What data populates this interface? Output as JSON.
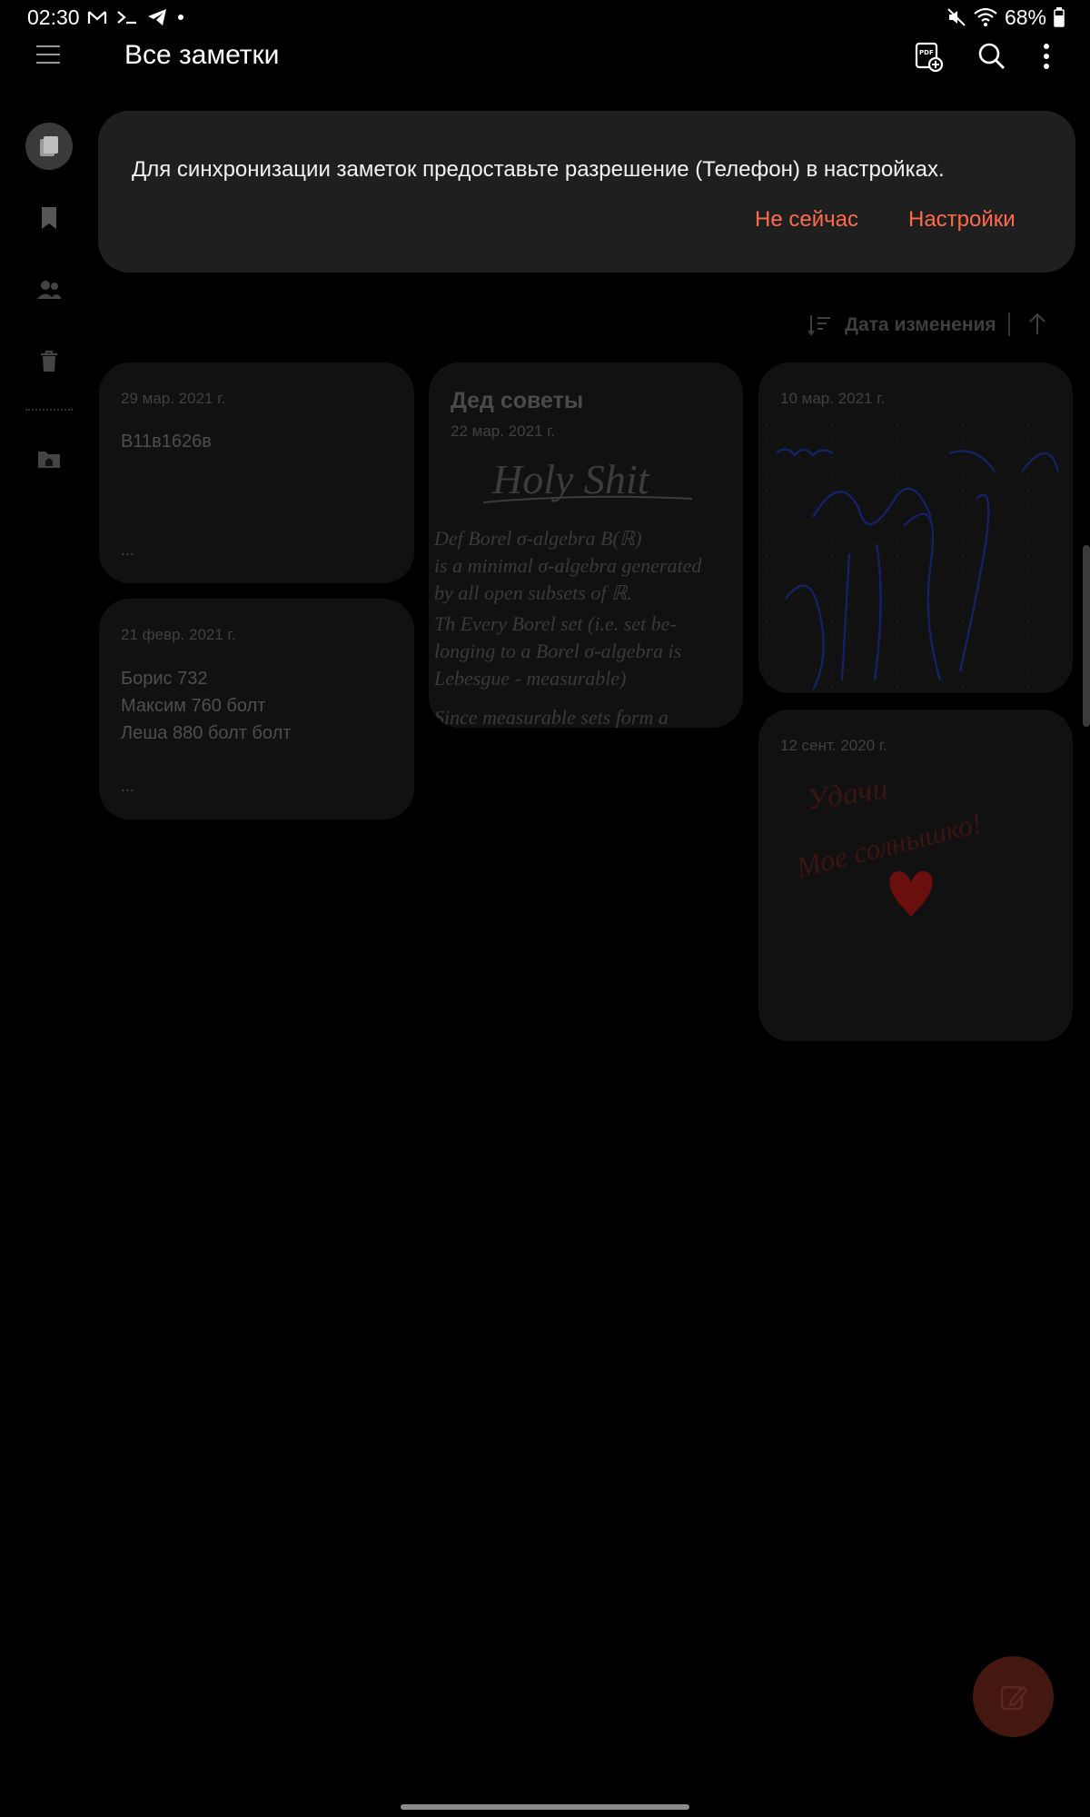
{
  "status_bar": {
    "time": "02:30",
    "left_icons": [
      "gmail-icon",
      "terminal-icon",
      "telegram-icon",
      "dot-icon"
    ],
    "battery": "68%"
  },
  "header": {
    "title": "Все заметки",
    "icons": [
      "menu-icon",
      "pdf-add-icon",
      "search-icon",
      "more-icon"
    ]
  },
  "sidebar": {
    "items": [
      "notes-icon",
      "bookmark-icon",
      "shared-icon",
      "trash-icon",
      "folder-home-icon"
    ]
  },
  "dialog": {
    "message": "Для синхронизации заметок предоставьте разрешение (Телефон) в настройках.",
    "not_now": "Не сейчас",
    "settings": "Настройки",
    "accent_color": "#ff6b4a"
  },
  "sort": {
    "label": "Дата изменения"
  },
  "notes": [
    {
      "date": "29 мар. 2021 г.",
      "text": "B11в1626в",
      "ellipsis": "..."
    },
    {
      "date": "21 февр. 2021 г.",
      "text": "Борис 732\nМаксим 760 болт\nЛеша 880 болт болт",
      "ellipsis": "..."
    },
    {
      "title": "Дед советы",
      "date": "22 мар. 2021 г.",
      "handwriting": {
        "title": "Holy Shit",
        "lines": [
          "Def Borel σ-algebra B(ℝ)",
          "is a minimal σ-algebra generated",
          "by all open subsets of ℝ.",
          "Th Every Borel set (i.e. set be-",
          "longing to a Borel σ-algebra is",
          "Lebesgue - measurable)",
          "Since measurable sets form a"
        ]
      }
    },
    {
      "date": "10 мар. 2021 г."
    },
    {
      "date": "12 сент. 2020 г.",
      "handwriting": {
        "lines": [
          "Удачи",
          "Мое солнышко!"
        ]
      }
    }
  ]
}
